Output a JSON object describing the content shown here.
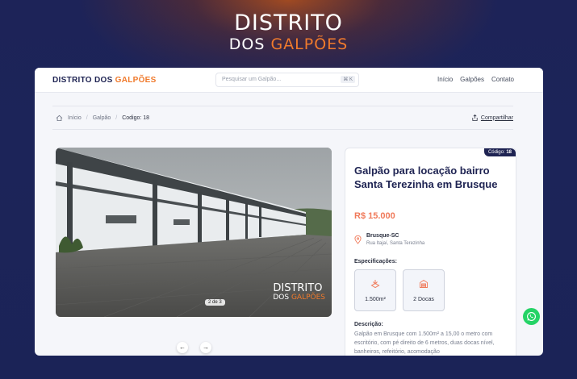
{
  "hero": {
    "line1": "DISTRITO",
    "line2_a": "DOS ",
    "line2_b": "GALPÕES"
  },
  "navbar": {
    "brand_a": "DISTRITO DOS ",
    "brand_b": "GALPÕES",
    "search_placeholder": "Pesquisar um Galpão...",
    "search_shortcut": "⌘ K",
    "links": [
      "Início",
      "Galpões",
      "Contato"
    ]
  },
  "breadcrumb": {
    "home": "Início",
    "section": "Galpão",
    "current": "Codigo: 18",
    "share": "Compartilhar"
  },
  "gallery": {
    "counter": "2 de 3",
    "watermark_a": "DISTRITO",
    "watermark_b1": "DOS ",
    "watermark_b2": "GALPÕES",
    "prev_icon": "arrow-left-icon",
    "next_icon": "arrow-right-icon"
  },
  "listing": {
    "code_label": "Código: ",
    "code_value": "18",
    "title": "Galpão para locação bairro Santa Terezinha em Brusque",
    "price": "R$ 15.000",
    "city": "Brusque-SC",
    "address": "Rua Itajaí, Santa Terezinha",
    "specs_title": "Especificações:",
    "specs": [
      {
        "icon": "area-icon",
        "value": "1.500m²"
      },
      {
        "icon": "dock-icon",
        "value": "2 Docas"
      }
    ],
    "description_title": "Descrição:",
    "description": "Galpão em Brusque com 1.500m² a 15,00 o metro com escritório, com pé direito de 6 metros, duas docas nível, banheiros, refeitório, acomodação"
  },
  "colors": {
    "navy": "#1e2352",
    "accent": "#f07a2c",
    "price": "#f07a5a",
    "whatsapp": "#25d366"
  }
}
